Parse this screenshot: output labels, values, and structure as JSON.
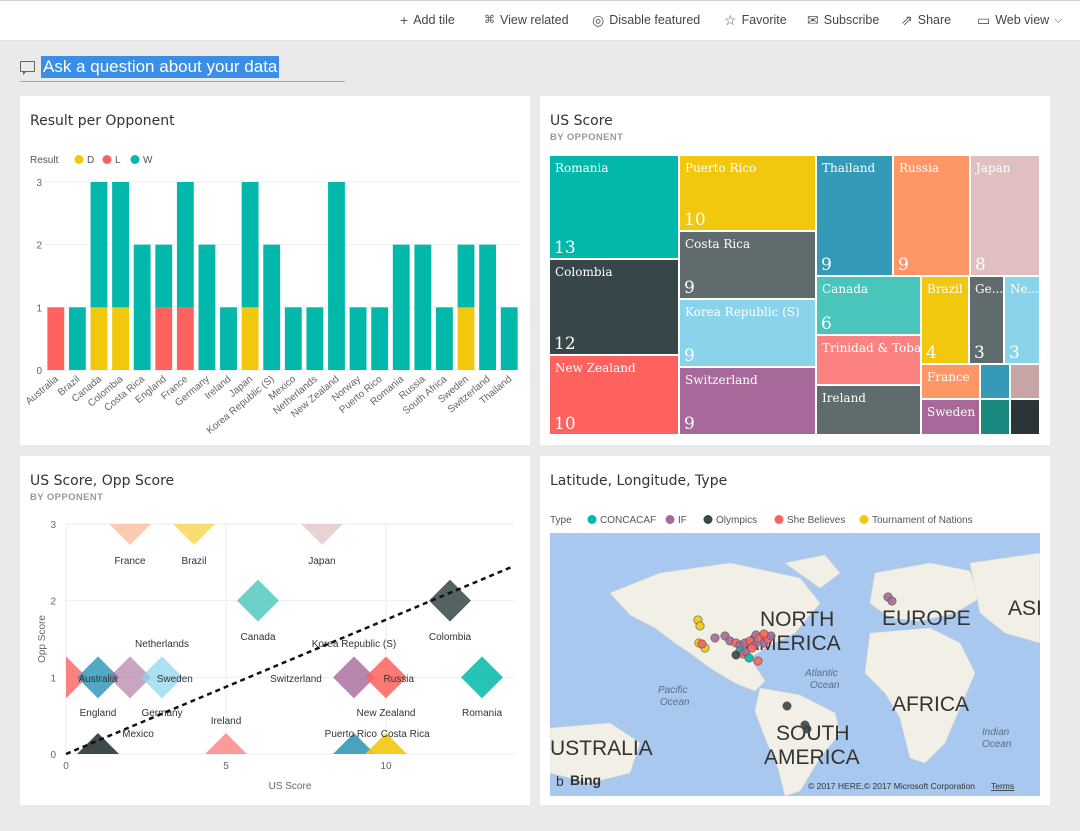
{
  "toolbar": {
    "add_tile": "Add tile",
    "view_related": "View related",
    "disable_featured": "Disable featured",
    "favorite": "Favorite",
    "subscribe": "Subscribe",
    "share": "Share",
    "web_view": "Web view"
  },
  "qa": {
    "placeholder": "Ask a question about your data"
  },
  "tile1": {
    "title": "Result per Opponent",
    "legend_label": "Result",
    "legend": [
      {
        "name": "D",
        "color": "#f2c80f"
      },
      {
        "name": "L",
        "color": "#fd625e"
      },
      {
        "name": "W",
        "color": "#01b8aa"
      }
    ]
  },
  "tile2": {
    "title": "US Score",
    "subtitle": "BY OPPONENT",
    "cells": [
      {
        "name": "Romania",
        "value": "13",
        "color": "#01b8aa"
      },
      {
        "name": "Puerto Rico",
        "value": "10",
        "color": "#f2c80f"
      },
      {
        "name": "Colombia",
        "value": "12",
        "color": "#374649"
      },
      {
        "name": "Costa Rica",
        "value": "9",
        "color": "#5f6b6d"
      },
      {
        "name": "New Zealand",
        "value": "10",
        "color": "#fd625e"
      },
      {
        "name": "Korea Republic (S)",
        "value": "9",
        "color": "#8ad4eb"
      },
      {
        "name": "Switzerland",
        "value": "9",
        "color": "#a66999"
      },
      {
        "name": "Thailand",
        "value": "9",
        "color": "#3599b8"
      },
      {
        "name": "Russia",
        "value": "9",
        "color": "#fe9666"
      },
      {
        "name": "Japan",
        "value": "8",
        "color": "#dfbfbf"
      },
      {
        "name": "Canada",
        "value": "6",
        "color": "#4ac5bb"
      },
      {
        "name": "Brazil",
        "value": "4",
        "color": "#f2c80f"
      },
      {
        "name": "Ge...",
        "value": "3",
        "color": "#5f6b6d"
      },
      {
        "name": "Ne...",
        "value": "3",
        "color": "#8ad4eb"
      },
      {
        "name": "Trinidad & Toba...",
        "value": "",
        "color": "#fb8281"
      },
      {
        "name": "Ireland",
        "value": "",
        "color": "#5f6b6d"
      },
      {
        "name": "France",
        "value": "",
        "color": "#fe9666"
      },
      {
        "name": "Sweden",
        "value": "",
        "color": "#a66999"
      },
      {
        "name": "",
        "value": "",
        "color": "#3599b8"
      },
      {
        "name": "",
        "value": "",
        "color": "#c8a5a5"
      },
      {
        "name": "",
        "value": "",
        "color": "#1a8a80"
      },
      {
        "name": "",
        "value": "",
        "color": "#2b3538"
      }
    ]
  },
  "tile3": {
    "title": "US Score, Opp Score",
    "subtitle": "BY OPPONENT"
  },
  "tile4": {
    "title": "Latitude, Longitude, Type",
    "legend_label": "Type",
    "legend": [
      {
        "name": "CONCACAF",
        "color": "#01b8aa"
      },
      {
        "name": "IF",
        "color": "#a66999"
      },
      {
        "name": "Olympics",
        "color": "#374649"
      },
      {
        "name": "She Believes",
        "color": "#fd625e"
      },
      {
        "name": "Tournament of Nations",
        "color": "#f2c80f"
      }
    ],
    "labels": {
      "na1": "NORTH",
      "na2": "AMERICA",
      "eu": "EUROPE",
      "asia": "ASI",
      "africa": "AFRICA",
      "sa1": "SOUTH",
      "sa2": "AMERICA",
      "aus": "USTRALIA",
      "atl1": "Atlantic",
      "atl2": "Ocean",
      "pac1": "Pacific",
      "pac2": "Ocean",
      "ind1": "Indian",
      "ind2": "Ocean"
    },
    "bing": "Bing",
    "copyright": "© 2017 HERE,© 2017 Microsoft Corporation",
    "terms": "Terms"
  },
  "chart_data": [
    {
      "type": "bar",
      "title": "Result per Opponent",
      "legend_title": "Result",
      "categories": [
        "Australia",
        "Brazil",
        "Canada",
        "Colombia",
        "Costa Rica",
        "England",
        "France",
        "Germany",
        "Ireland",
        "Japan",
        "Korea Republic (S)",
        "Mexico",
        "Netherlands",
        "New Zealand",
        "Norway",
        "Puerto Rico",
        "Romania",
        "Russia",
        "South Africa",
        "Sweden",
        "Switzerland",
        "Thailand"
      ],
      "series": [
        {
          "name": "L",
          "color": "#fd625e",
          "values": [
            1,
            0,
            0,
            0,
            0,
            1,
            1,
            0,
            0,
            0,
            0,
            0,
            0,
            0,
            0,
            0,
            0,
            0,
            0,
            0,
            0,
            0
          ]
        },
        {
          "name": "D",
          "color": "#f2c80f",
          "values": [
            0,
            0,
            1,
            1,
            0,
            0,
            0,
            0,
            0,
            1,
            0,
            0,
            0,
            0,
            0,
            0,
            0,
            0,
            0,
            1,
            0,
            0
          ]
        },
        {
          "name": "W",
          "color": "#01b8aa",
          "values": [
            0,
            1,
            2,
            2,
            2,
            1,
            2,
            2,
            1,
            2,
            2,
            1,
            1,
            3,
            1,
            1,
            2,
            2,
            1,
            1,
            2,
            1
          ]
        }
      ],
      "yticks": [
        0,
        1,
        2,
        3
      ],
      "ylim": [
        0,
        3
      ],
      "stacked": true
    },
    {
      "type": "scatter",
      "title": "US Score, Opp Score",
      "subtitle": "BY OPPONENT",
      "xlabel": "US Score",
      "ylabel": "Opp Score",
      "xlim": [
        0,
        14
      ],
      "ylim": [
        0,
        3
      ],
      "xticks": [
        0,
        5,
        10
      ],
      "yticks": [
        0,
        1,
        2,
        3
      ],
      "points": [
        {
          "label": "France",
          "x": 2,
          "y": 3,
          "color": "#fe9666",
          "opacity": 0.5
        },
        {
          "label": "Brazil",
          "x": 4,
          "y": 3,
          "color": "#f2c80f",
          "opacity": 0.6
        },
        {
          "label": "Japan",
          "x": 8,
          "y": 3,
          "color": "#dfbfbf",
          "opacity": 0.7
        },
        {
          "label": "Canada",
          "x": 6,
          "y": 2,
          "color": "#4ac5bb",
          "opacity": 0.8
        },
        {
          "label": "Colombia",
          "x": 12,
          "y": 2,
          "color": "#374649",
          "opacity": 0.85
        },
        {
          "label": "Netherlands",
          "x": 3,
          "y": 1.5,
          "color": "#8ad4eb",
          "opacity": 0
        },
        {
          "label": "Korea Republic (S)",
          "x": 9,
          "y": 1.5,
          "color": "#8ad4eb",
          "opacity": 0
        },
        {
          "label": "England",
          "x": 0,
          "y": 1,
          "color": "#fd625e",
          "opacity": 0.8
        },
        {
          "label": "Australia",
          "x": 1,
          "y": 1,
          "color": "#3599b8",
          "opacity": 0.85
        },
        {
          "label": "Germany",
          "x": 2,
          "y": 1,
          "color": "#a66999",
          "opacity": 0.6
        },
        {
          "label": "Sweden",
          "x": 3,
          "y": 1,
          "color": "#8ad4eb",
          "opacity": 0.7
        },
        {
          "label": "Switzerland",
          "x": 9,
          "y": 1,
          "color": "#a66999",
          "opacity": 0.8
        },
        {
          "label": "Russia",
          "x": 10,
          "y": 1,
          "color": "#fd625e",
          "opacity": 0.85
        },
        {
          "label": "New Zealand",
          "x": 10,
          "y": 1,
          "color": "#fd625e",
          "opacity": 0
        },
        {
          "label": "Romania",
          "x": 13,
          "y": 1,
          "color": "#01b8aa",
          "opacity": 0.85
        },
        {
          "label": "Mexico",
          "x": 1,
          "y": 0,
          "color": "#2b3538",
          "opacity": 0.9
        },
        {
          "label": "Ireland",
          "x": 5,
          "y": 0,
          "color": "#fb8281",
          "opacity": 0.8
        },
        {
          "label": "Puerto Rico",
          "x": 9,
          "y": 0,
          "color": "#3599b8",
          "opacity": 0.9
        },
        {
          "label": "Costa Rica",
          "x": 10,
          "y": 0,
          "color": "#f2c80f",
          "opacity": 0.9
        }
      ],
      "trendline": true
    }
  ]
}
